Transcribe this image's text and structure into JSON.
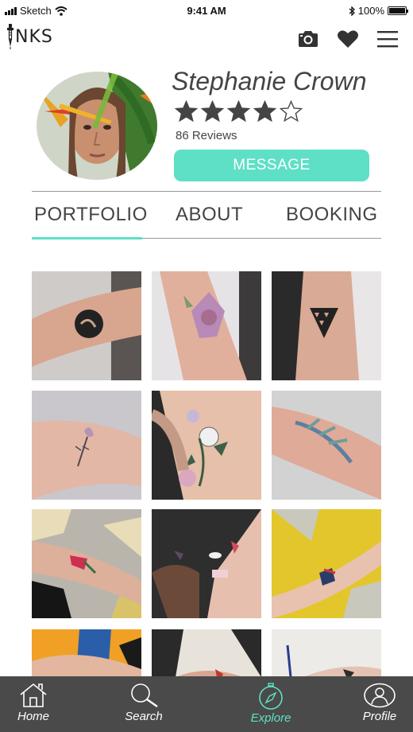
{
  "status_bar": {
    "carrier": "Sketch",
    "time": "9:41 AM",
    "battery": "100%",
    "battery_level": 1.0
  },
  "header": {
    "logo_text": "NKS",
    "icons": [
      "camera-icon",
      "heart-icon",
      "menu-icon"
    ]
  },
  "profile": {
    "name": "Stephanie Crown",
    "rating": 4,
    "rating_max": 5,
    "reviews": "86 Reviews",
    "message_label": "MESSAGE"
  },
  "tabs": [
    {
      "label": "PORTFOLIO",
      "active": true
    },
    {
      "label": "ABOUT",
      "active": false
    },
    {
      "label": "BOOKING",
      "active": false
    }
  ],
  "portfolio_tiles": [
    "arm-tattoo-circle-bird",
    "arm-tattoo-rose",
    "arm-tattoo-triangle",
    "arm-tattoo-flower-bud",
    "thigh-tattoo-flowers",
    "arm-tattoo-leaves",
    "arm-tattoo-watercolor-gray",
    "wrists-tattoo-matching",
    "arm-tattoo-watercolor-yellow",
    "arm-tattoo-abstract-blue",
    "arm-tattoo-abstract-dark",
    "arm-tattoo-small-light"
  ],
  "bottom_nav": [
    {
      "label": "Home",
      "icon": "home-icon",
      "active": false
    },
    {
      "label": "Search",
      "icon": "search-icon",
      "active": false
    },
    {
      "label": "Explore",
      "icon": "compass-icon",
      "active": true
    },
    {
      "label": "Profile",
      "icon": "user-icon",
      "active": false
    }
  ],
  "colors": {
    "accent": "#5ee0c6",
    "nav_background": "#4a4a4a",
    "text": "#444444"
  }
}
